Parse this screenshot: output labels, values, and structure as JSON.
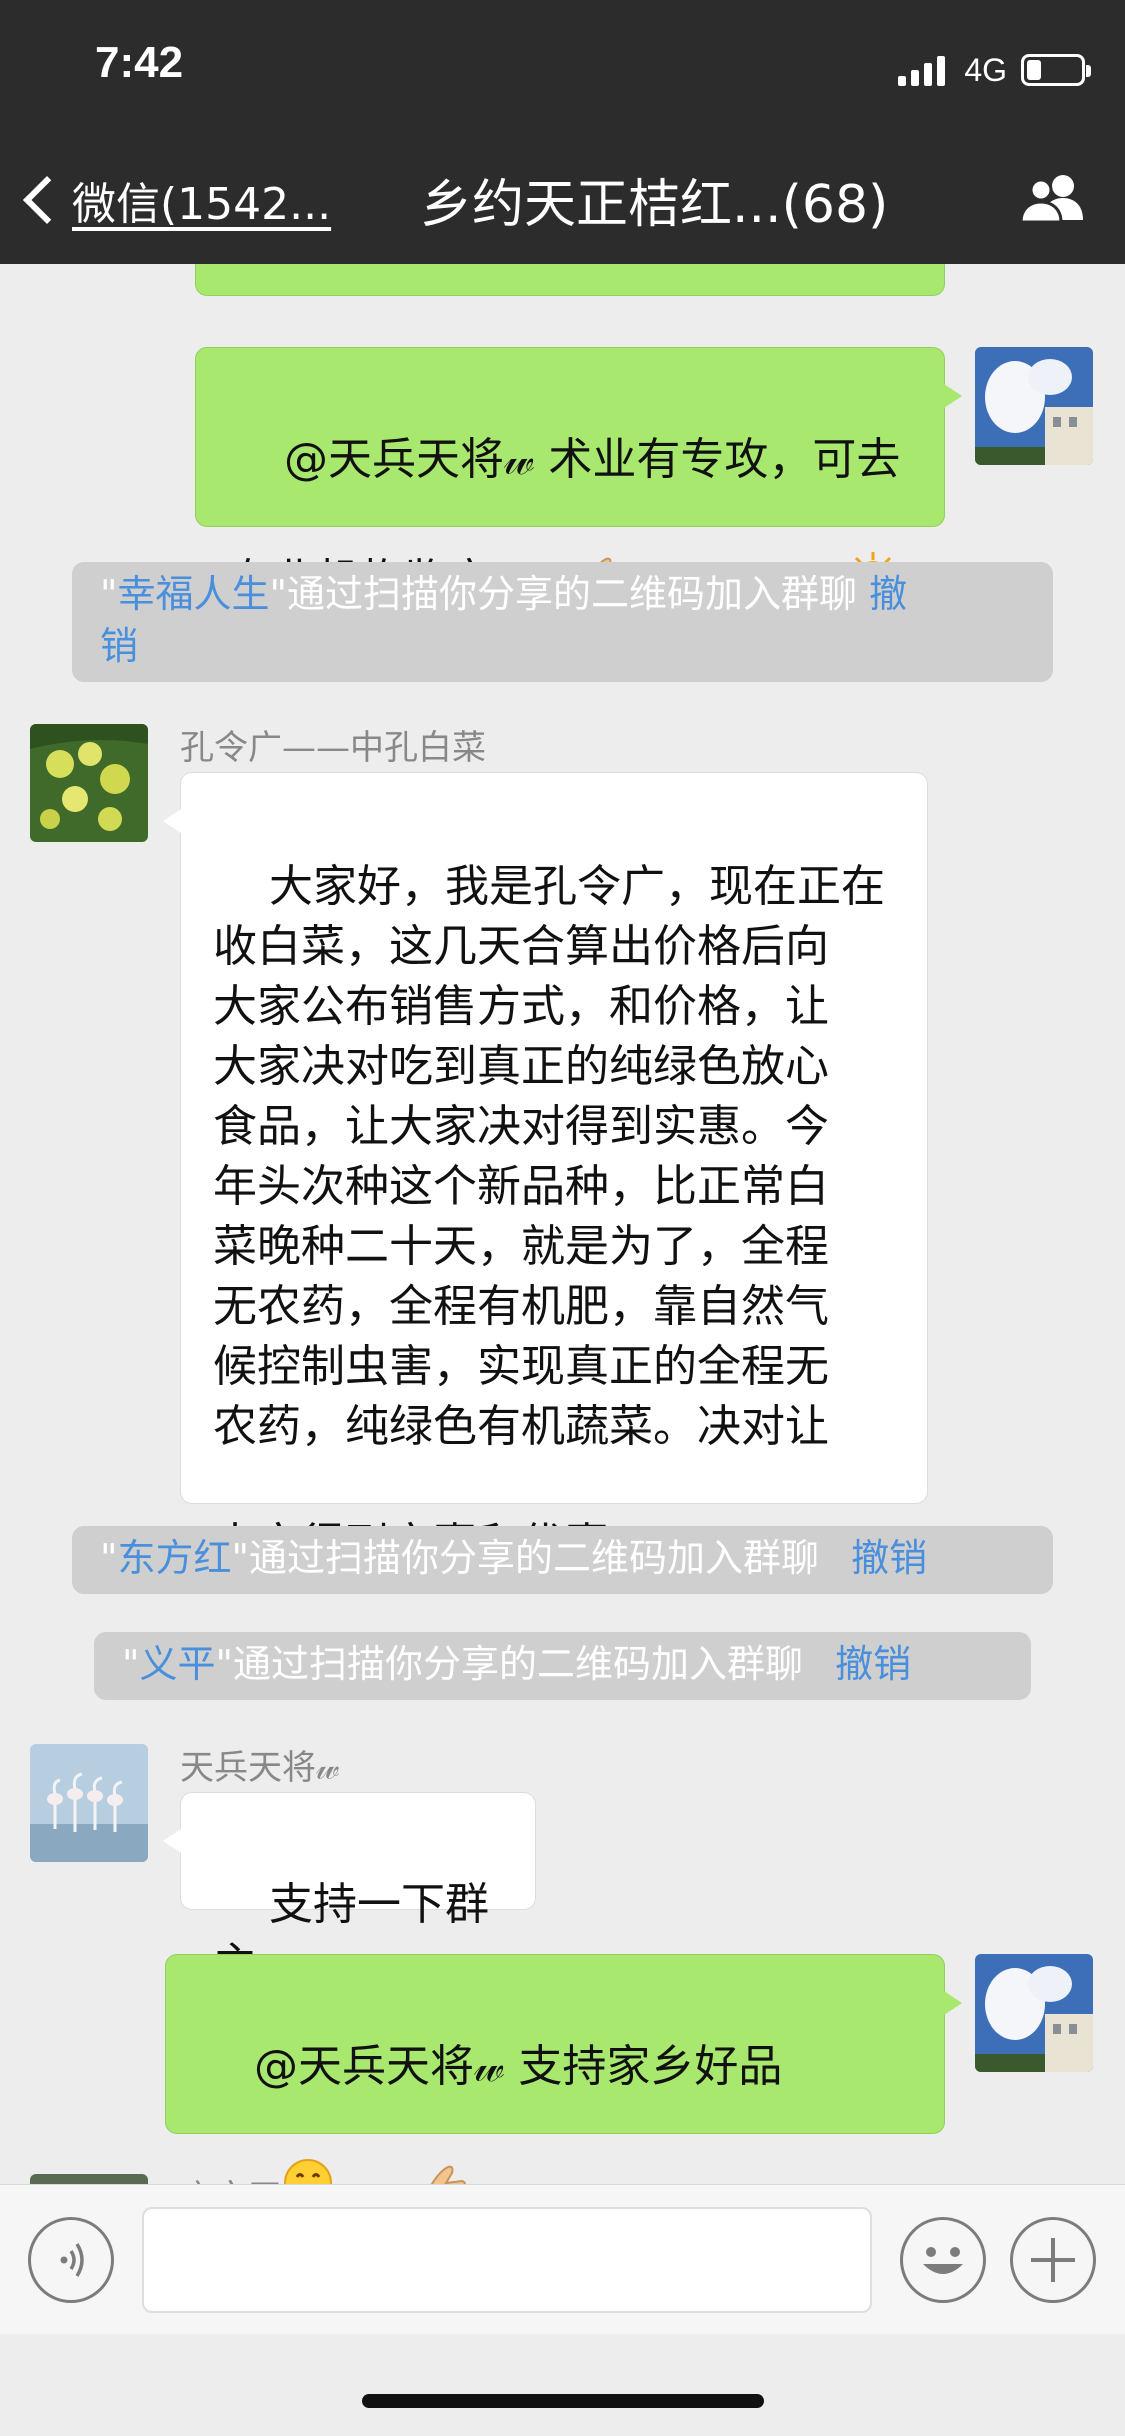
{
  "status_bar": {
    "time": "7:42",
    "network": "4G"
  },
  "header": {
    "back_label": "微信(1542...",
    "title": "乡约天正桔红...(68)"
  },
  "messages": {
    "partial_top_bubble": "",
    "msg1": {
      "text": "@天兵天将𝓌 术业有专攻，可去\n专业机构鉴定"
    },
    "sys1": {
      "name": "幸福人生",
      "text": "\"通过扫描你分享的二维码加入群聊",
      "undo": "撤\n销"
    },
    "msg2": {
      "sender": "孔令广——中孔白菜",
      "text": "大家好，我是孔令广，现在正在\n收白菜，这几天合算出价格后向\n大家公布销售方式，和价格，让\n大家决对吃到真正的纯绿色放心\n食品，让大家决对得到实惠。今\n年头次种这个新品种，比正常白\n菜晚种二十天，就是为了，全程\n无农药，全程有机肥，靠自然气\n候控制虫害，实现真正的全程无\n农药，纯绿色有机蔬菜。决对让\n大家得到实惠和优惠"
    },
    "sys2": {
      "name": "东方红",
      "text": "\"通过扫描你分享的二维码加入群聊",
      "undo": "撤销"
    },
    "sys3": {
      "name": "义平",
      "text": "\"通过扫描你分享的二维码加入群聊",
      "undo": "撤销"
    },
    "msg3": {
      "sender": "天兵天将𝓌",
      "text": "支持一下群主"
    },
    "msg4": {
      "text": "@天兵天将𝓌 支持家乡好品"
    },
    "partial_bottom_sender": "庆文王"
  },
  "icons": {
    "back": "chevron-left-icon",
    "members": "group-members-icon",
    "voice": "voice-input-icon",
    "emoji": "emoji-smile-icon",
    "more": "plus-icon"
  },
  "colors": {
    "header": "#2c2c2c",
    "bubble_green": "#a9e86f",
    "link": "#4a8fdc",
    "background": "#ededed"
  }
}
